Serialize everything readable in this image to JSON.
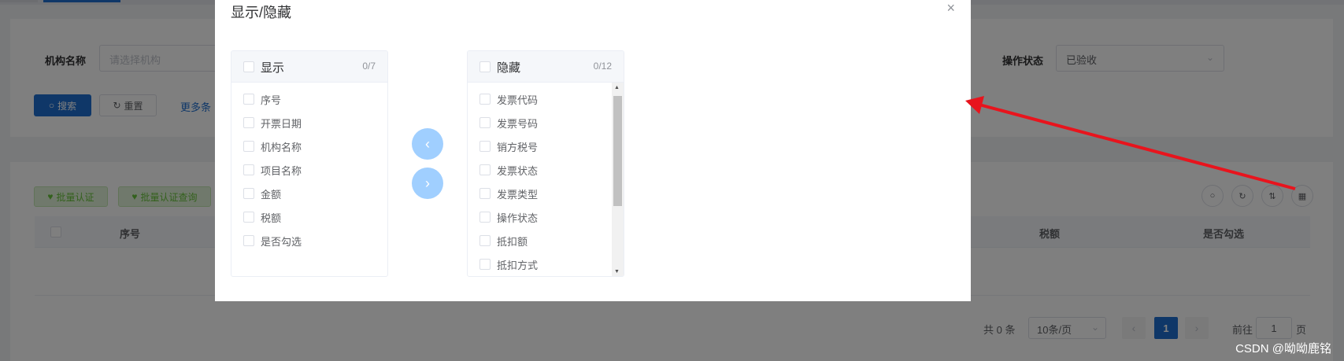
{
  "background": {
    "search_form": {
      "org_label": "机构名称",
      "org_placeholder": "请选择机构",
      "op_status_label": "操作状态",
      "op_status_value": "已验收",
      "search_button": "搜索",
      "reset_button": "重置",
      "more_link": "更多条"
    },
    "table": {
      "batch_verify": "批量认证",
      "batch_verify_query": "批量认证查询",
      "columns": [
        "序号",
        "税额",
        "是否勾选"
      ]
    },
    "pagination": {
      "total": "共 0 条",
      "page_size": "10条/页",
      "current_page": "1",
      "goto_prefix": "前往",
      "goto_value": "1",
      "goto_suffix": "页",
      "prev": "‹",
      "next": "›"
    }
  },
  "dialog": {
    "title": "显示/隐藏",
    "close": "×",
    "left_panel": {
      "title": "显示",
      "count": "0/7",
      "items": [
        "序号",
        "开票日期",
        "机构名称",
        "项目名称",
        "金额",
        "税额",
        "是否勾选"
      ]
    },
    "right_panel": {
      "title": "隐藏",
      "count": "0/12",
      "items": [
        "发票代码",
        "发票号码",
        "销方税号",
        "发票状态",
        "发票类型",
        "操作状态",
        "抵扣额",
        "抵扣方式"
      ]
    },
    "move_left": "‹",
    "move_right": "›"
  },
  "watermark": "CSDN @呦呦鹿铭",
  "colors": {
    "primary": "#1f6fd1",
    "transfer_button": "#a0cfff",
    "annotation_arrow": "#e8141d"
  },
  "icons": {
    "search": "search-icon",
    "refresh": "refresh-icon",
    "sort": "sort-icon",
    "grid": "grid-icon",
    "close": "close-icon"
  }
}
